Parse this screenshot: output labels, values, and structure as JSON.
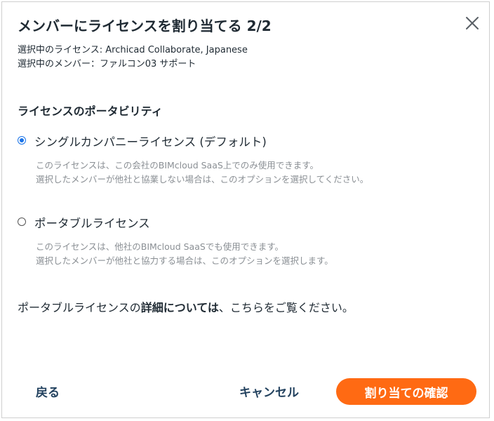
{
  "dialog": {
    "title": "メンバーにライセンスを割り当てる 2/2",
    "selected_license": "選択中のライセンス: Archicad Collaborate, Japanese",
    "selected_member": "選択中のメンバー：ファルコン03 サポート"
  },
  "portability": {
    "heading": "ライセンスのポータビリティ",
    "options": [
      {
        "label": "シングルカンパニーライセンス (デフォルト)",
        "checked": true,
        "desc_line1": "このライセンスは、この会社のBIMcloud SaaS上でのみ使用できます。",
        "desc_line2": "選択したメンバーが他社と協業しない場合は、このオプションを選択してください。"
      },
      {
        "label": "ポータブルライセンス",
        "checked": false,
        "desc_line1": "このライセンスは、他社のBIMcloud SaaSでも使用できます。",
        "desc_line2": "選択したメンバーが他社と協力する場合は、このオプションを選択します。"
      }
    ]
  },
  "info": {
    "prefix": "ポータブルライセンスの",
    "bold": "詳細については",
    "suffix": "、こちらをご覧ください。"
  },
  "footer": {
    "back": "戻る",
    "cancel": "キャンセル",
    "confirm": "割り当ての確認"
  },
  "colors": {
    "accent": "#ff6a13",
    "radio": "#1a73e8",
    "text": "#1f2a33",
    "muted": "#8a8f94",
    "button_text": "#23425f"
  },
  "icons": {
    "close": "close-icon"
  }
}
